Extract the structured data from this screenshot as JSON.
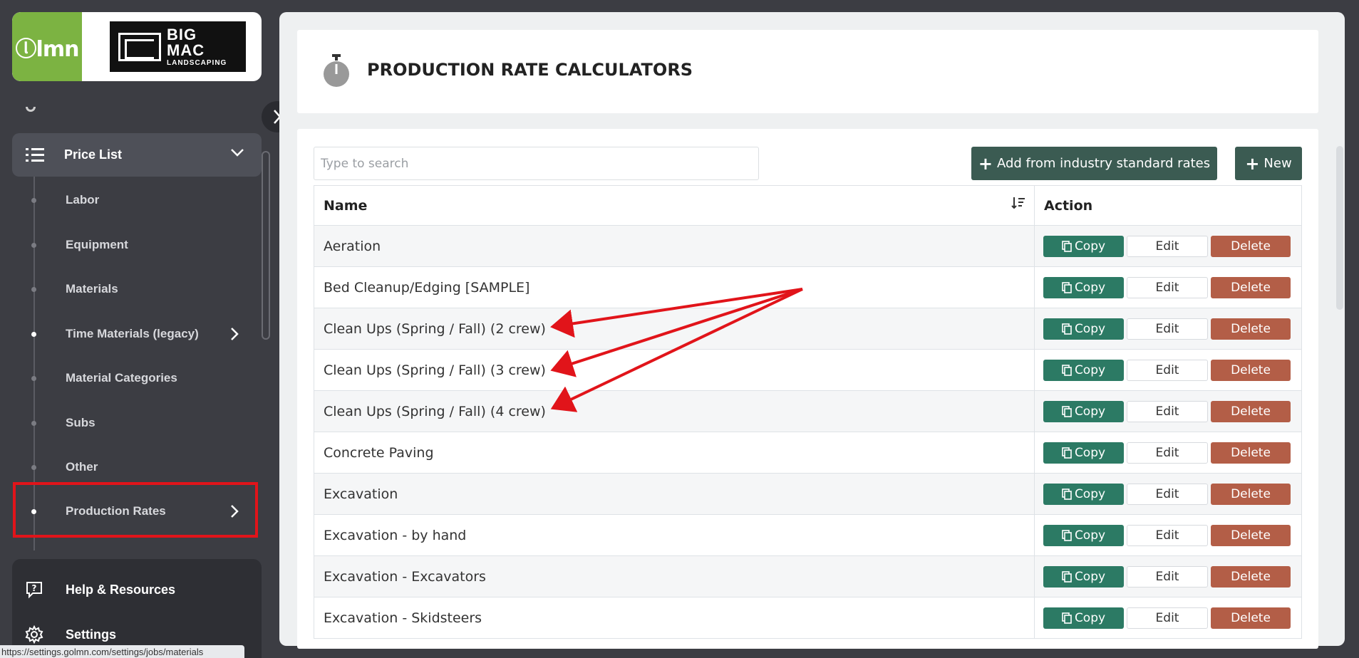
{
  "brand": {
    "lmn_logo": "ⓛlmn",
    "company_logo_big": "BIG",
    "company_logo_mac": "MAC",
    "company_logo_small": "LANDSCAPING"
  },
  "sidebar": {
    "parent": {
      "label": "Price List",
      "icon": "list-icon",
      "expanded": true
    },
    "items": [
      {
        "label": "Labor",
        "active": false,
        "has_children": false
      },
      {
        "label": "Equipment",
        "active": false,
        "has_children": false
      },
      {
        "label": "Materials",
        "active": false,
        "has_children": false
      },
      {
        "label": "Time Materials (legacy)",
        "active": true,
        "has_children": true
      },
      {
        "label": "Material Categories",
        "active": false,
        "has_children": false
      },
      {
        "label": "Subs",
        "active": false,
        "has_children": false
      },
      {
        "label": "Other",
        "active": false,
        "has_children": false
      },
      {
        "label": "Production Rates",
        "active": true,
        "has_children": true
      }
    ],
    "bottom": [
      {
        "label": "Help & Resources",
        "icon": "help-icon"
      },
      {
        "label": "Settings",
        "icon": "gear-icon"
      }
    ]
  },
  "status_url": "https://settings.golmn.com/settings/jobs/materials",
  "page": {
    "title": "PRODUCTION RATE CALCULATORS",
    "title_icon": "stopwatch-icon"
  },
  "toolbar": {
    "search_placeholder": "Type to search",
    "add_industry_label": "Add from industry standard rates",
    "new_label": "New"
  },
  "table": {
    "headers": {
      "name": "Name",
      "action": "Action"
    },
    "action_labels": {
      "copy": "Copy",
      "edit": "Edit",
      "delete": "Delete"
    },
    "rows": [
      "Aeration",
      "Bed Cleanup/Edging [SAMPLE]",
      "Clean Ups (Spring / Fall) (2 crew)",
      "Clean Ups (Spring / Fall) (3 crew)",
      "Clean Ups (Spring / Fall) (4 crew)",
      "Concrete Paving",
      "Excavation",
      "Excavation - by hand",
      "Excavation - Excavators",
      "Excavation - Skidsteers"
    ]
  },
  "colors": {
    "background": "#3c3d43",
    "lmn_green": "#7cb342",
    "dark_button": "#3b5b52",
    "copy_button": "#2c7a64",
    "delete_button": "#b35e47",
    "annotation_red": "#e1141a"
  }
}
